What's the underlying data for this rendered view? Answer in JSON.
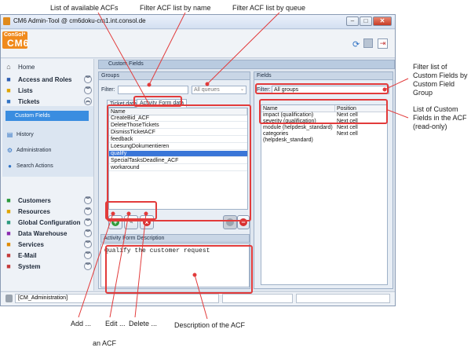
{
  "callouts": {
    "list_acfs": "List of  available ACFs",
    "filter_name": "Filter ACF list by name",
    "filter_queue": "Filter ACF list by queue",
    "filter_custom_fields": "Filter list of Custom Fields by Custom Field Group",
    "list_custom_fields": "List of Custom Fields in the ACF (read-only)",
    "add": "Add ...",
    "edit": "Edit ...",
    "delete": "Delete ...",
    "an_acf": "an ACF",
    "description": "Description of  the ACF"
  },
  "window": {
    "title": "CM6 Admin-Tool @ cm6doku-cm1.int.consol.de",
    "logo_top": "ConSol*",
    "logo_main": "CM6"
  },
  "sidebar": {
    "home": "Home",
    "items": [
      {
        "label": "Access and Roles",
        "icon": "heart-icon",
        "color": "#2f5fb3"
      },
      {
        "label": "Lists",
        "icon": "list-icon",
        "color": "#e0a400"
      },
      {
        "label": "Tickets",
        "icon": "ticket-icon",
        "color": "#2f72c4"
      },
      {
        "label": "Customers",
        "icon": "person-icon",
        "color": "#2a9a3b"
      },
      {
        "label": "Resources",
        "icon": "resources-icon",
        "color": "#e0a400"
      },
      {
        "label": "Global Configuration",
        "icon": "globe-icon",
        "color": "#2a9a7f"
      },
      {
        "label": "Data Warehouse",
        "icon": "database-icon",
        "color": "#8a2ab0"
      },
      {
        "label": "Services",
        "icon": "gear-icon",
        "color": "#e08a00"
      },
      {
        "label": "E-Mail",
        "icon": "mail-icon",
        "color": "#c43a3a"
      },
      {
        "label": "System",
        "icon": "system-icon",
        "color": "#c43a3a"
      }
    ],
    "ticket_subs": [
      "Custom Fields",
      "History",
      "Administration",
      "Search Actions"
    ]
  },
  "content": {
    "panel_title": "Custom Fields",
    "groups": {
      "heading": "Groups",
      "filter_label": "Filter:",
      "queue_placeholder": "All queues",
      "tabs": [
        "Ticket data",
        "Activity Form data"
      ],
      "column": "Name",
      "rows": [
        "CreateBid_ACF",
        "DeleteThoseTickets",
        "DismissTicketACF",
        "feedback",
        "LoesungDokumentieren",
        "qualify",
        "SpecialTasksDeadline_ACF",
        "workaround"
      ],
      "selected": "qualify",
      "description_heading": "Activity Form Description",
      "description_text": "Qualify the customer request"
    },
    "fields": {
      "heading": "Fields",
      "filter_label": "Filter:",
      "filter_value": "All groups",
      "columns": [
        "Name",
        "Position"
      ],
      "rows": [
        [
          "impact (qualification)",
          "Next cell"
        ],
        [
          "severity (qualification)",
          "Next cell"
        ],
        [
          "module (helpdesk_standard)",
          "Next cell"
        ],
        [
          "categories (helpdesk_standard)",
          "Next cell"
        ]
      ]
    }
  },
  "status": {
    "user": "[CM_Administration]"
  },
  "colors": {
    "accent": "#3a76d8",
    "callout_border": "#e23b3b",
    "logo": "#f08a1c"
  }
}
